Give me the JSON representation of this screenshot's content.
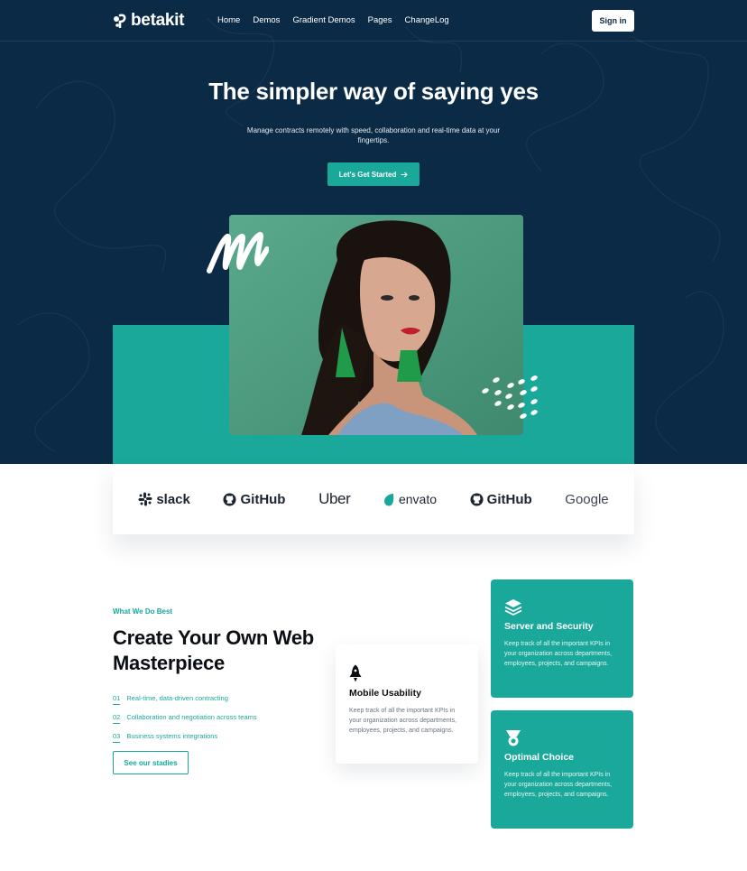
{
  "nav": {
    "logo_text": "betakit",
    "links": [
      "Home",
      "Demos",
      "Gradient Demos",
      "Pages",
      "ChangeLog"
    ],
    "signin_label": "Sign in"
  },
  "hero": {
    "title": "The simpler way of saying yes",
    "subtitle": "Manage contracts remotely with speed, collaboration and real-time data at your fingertips.",
    "cta_label": "Let's Get Started",
    "cta_icon": "arrow-right-icon"
  },
  "brands": [
    "slack",
    "GitHub",
    "Uber",
    "envato",
    "GitHub",
    "Google"
  ],
  "features": {
    "eyebrow": "What We Do Best",
    "title": "Create Your Own Web Masterpiece",
    "items": [
      {
        "num": "01",
        "text": "Real-time, data-driven contracting"
      },
      {
        "num": "02",
        "text": "Collaboration and negotiation across teams"
      },
      {
        "num": "03",
        "text": "Business systems integrations"
      }
    ],
    "button_label": "See our stadies"
  },
  "cards": [
    {
      "title": "Mobile Usability",
      "text": "Keep track of all the important KPIs in your organization across departments, employees, projects, and campaigns.",
      "icon": "rocket-icon"
    },
    {
      "title": "Server and Security",
      "text": "Keep track of all the important KPIs in your organization across departments, employees, projects, and campaigns.",
      "icon": "layers-icon"
    },
    {
      "title": "Optimal Choice",
      "text": "Keep track of all the important KPIs in your organization across departments, employees, projects, and campaigns.",
      "icon": "award-icon"
    }
  ],
  "colors": {
    "navy": "#0b2a45",
    "teal": "#1aa89a",
    "white": "#ffffff"
  }
}
